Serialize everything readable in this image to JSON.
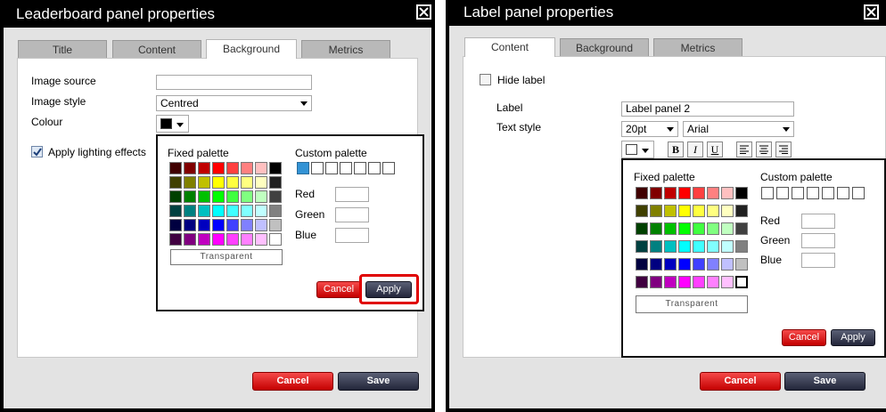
{
  "dialog1": {
    "title": "Leaderboard panel properties",
    "tabs": [
      "Title",
      "Content",
      "Background",
      "Metrics"
    ],
    "active_tab": "Background",
    "fields": {
      "image_source": {
        "label": "Image source",
        "value": ""
      },
      "image_style": {
        "label": "Image style",
        "value": "Centred"
      },
      "colour": {
        "label": "Colour",
        "swatch": "#000000"
      },
      "lighting": {
        "label": "Apply lighting effects",
        "checked": true
      }
    },
    "palette": {
      "fixed_label": "Fixed palette",
      "custom_label": "Custom palette",
      "red_label": "Red",
      "green_label": "Green",
      "blue_label": "Blue",
      "transparent_label": "Transparent",
      "cancel_label": "Cancel",
      "apply_label": "Apply"
    },
    "buttons": {
      "cancel": "Cancel",
      "save": "Save"
    }
  },
  "dialog2": {
    "title": "Label panel properties",
    "tabs": [
      "Content",
      "Background",
      "Metrics"
    ],
    "active_tab": "Content",
    "hide_label": {
      "label": "Hide label",
      "checked": false
    },
    "fields": {
      "label": {
        "label": "Label",
        "value": "Label panel 2"
      },
      "text_style": {
        "label": "Text style",
        "size": "20pt",
        "font": "Arial"
      }
    },
    "format_buttons": {
      "bold": "B",
      "italic": "I",
      "underline": "U"
    },
    "palette": {
      "fixed_label": "Fixed palette",
      "custom_label": "Custom palette",
      "red_label": "Red",
      "green_label": "Green",
      "blue_label": "Blue",
      "transparent_label": "Transparent",
      "cancel_label": "Cancel",
      "apply_label": "Apply"
    },
    "buttons": {
      "cancel": "Cancel",
      "save": "Save"
    }
  },
  "fixed_palette_colors": [
    "#400000",
    "#800000",
    "#c00000",
    "#ff0000",
    "#ff4040",
    "#ff8080",
    "#ffc0c0",
    "#000000",
    "#404000",
    "#808000",
    "#c0c000",
    "#ffff00",
    "#ffff40",
    "#ffff80",
    "#ffffc0",
    "#202020",
    "#004000",
    "#008000",
    "#00c000",
    "#00ff00",
    "#40ff40",
    "#80ff80",
    "#c0ffc0",
    "#404040",
    "#004040",
    "#008080",
    "#00c0c0",
    "#00ffff",
    "#40ffff",
    "#80ffff",
    "#c0ffff",
    "#808080",
    "#000040",
    "#000080",
    "#0000c0",
    "#0000ff",
    "#4040ff",
    "#8080ff",
    "#c0c0ff",
    "#c0c0c0",
    "#400040",
    "#800080",
    "#c000c0",
    "#ff00ff",
    "#ff40ff",
    "#ff80ff",
    "#ffc0ff",
    "#ffffff"
  ],
  "custom_palette_1": [
    "#3393d5",
    "#ffffff",
    "#ffffff",
    "#ffffff",
    "#ffffff",
    "#ffffff",
    "#ffffff"
  ],
  "custom_palette_2": [
    "#ffffff",
    "#ffffff",
    "#ffffff",
    "#ffffff",
    "#ffffff",
    "#ffffff",
    "#ffffff"
  ]
}
